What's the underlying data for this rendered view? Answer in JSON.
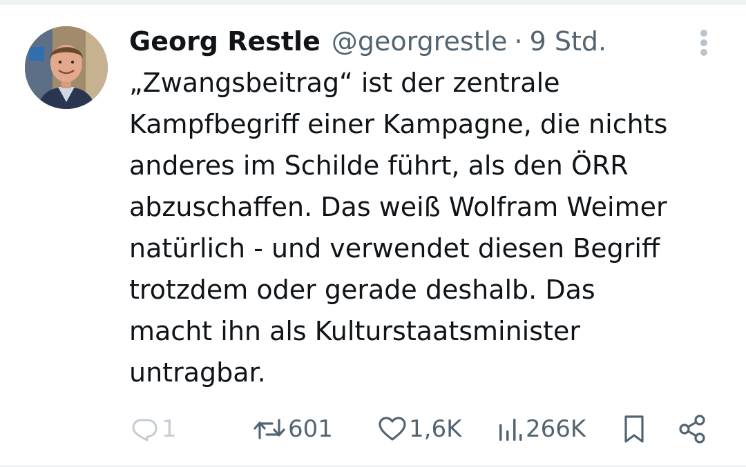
{
  "tweet": {
    "author": {
      "display_name": "Georg Restle",
      "handle": "@georgrestle"
    },
    "separator": "·",
    "time": "9 Std.",
    "text": "„Zwangsbeitrag“ ist der zentrale\nKampfbegriff einer Kampagne, die nichts\nanderes im Schilde führt, als den ÖRR\nabzuschaffen. Das weiß Wolfram Weimer\nnatürlich - und verwendet diesen Begriff\ntrotzdem oder gerade deshalb. Das\nmacht ihn als Kulturstaatsminister\nuntragbar.",
    "actions": {
      "replies": "1",
      "retweets": "601",
      "likes": "1,6K",
      "views": "266K"
    },
    "icons": {
      "reply": "reply-bubble-icon",
      "retweet": "retweet-icon",
      "like": "heart-icon",
      "views": "views-chart-icon",
      "bookmark": "bookmark-icon",
      "share": "share-icon",
      "more": "more-vertical-icon"
    },
    "colors": {
      "text": "#0f1419",
      "secondary": "#536471",
      "disabled": "#c5ccd3"
    }
  }
}
